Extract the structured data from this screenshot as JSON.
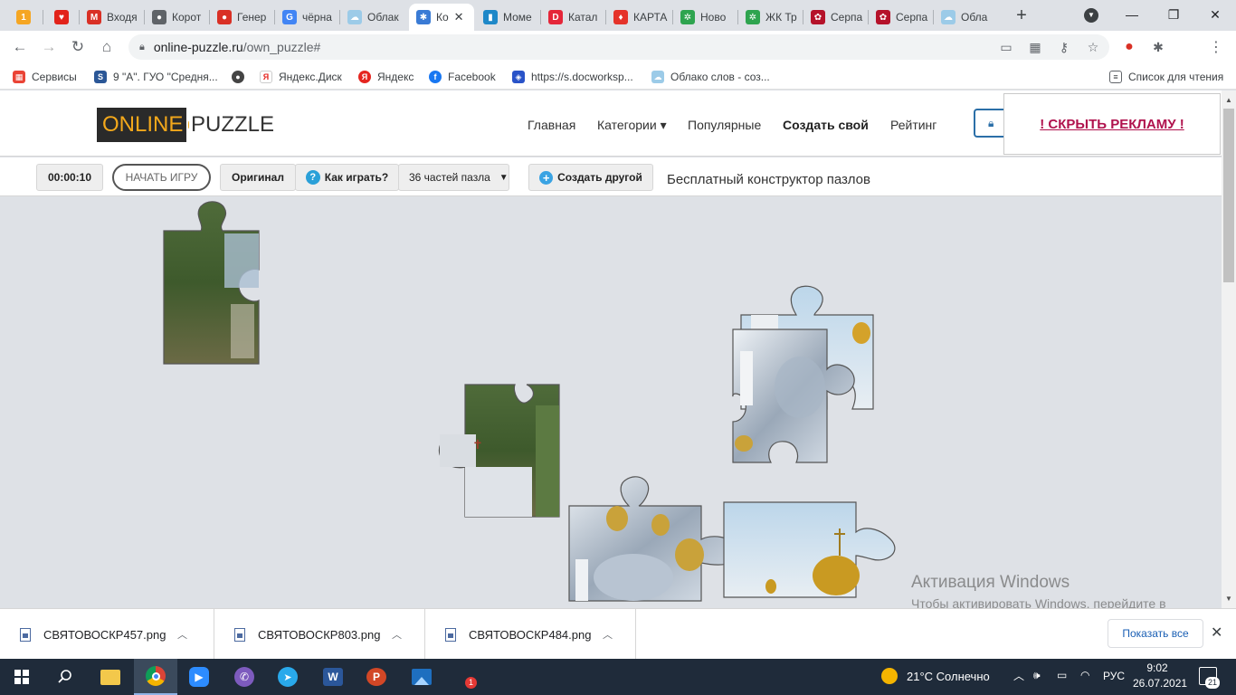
{
  "browser": {
    "tabs": [
      {
        "label": "",
        "color": "#f5a623",
        "glyph": "1"
      },
      {
        "label": "",
        "color": "#e2231a",
        "glyph": "♥"
      },
      {
        "label": "Входя",
        "color": "#d93025",
        "glyph": "M"
      },
      {
        "label": "Корот",
        "color": "#5f6368",
        "glyph": "●"
      },
      {
        "label": "Генер",
        "color": "#d93025",
        "glyph": "●"
      },
      {
        "label": "чёрна",
        "color": "#4285f4",
        "glyph": "G"
      },
      {
        "label": "Облак",
        "color": "#9ccbe8",
        "glyph": "☁"
      },
      {
        "label": "Ко",
        "color": "#3a7bd5",
        "glyph": "✱"
      },
      {
        "label": "Моме",
        "color": "#1e88c8",
        "glyph": "▮"
      },
      {
        "label": "Катал",
        "color": "#e52639",
        "glyph": "D"
      },
      {
        "label": "КАРТА",
        "color": "#e5332a",
        "glyph": "♦"
      },
      {
        "label": "Ново",
        "color": "#2ea44f",
        "glyph": "✲"
      },
      {
        "label": "ЖК Тр",
        "color": "#2ea44f",
        "glyph": "✲"
      },
      {
        "label": "Серпа",
        "color": "#b5122a",
        "glyph": "✿"
      },
      {
        "label": "Серпа",
        "color": "#b5122a",
        "glyph": "✿"
      },
      {
        "label": "Обла",
        "color": "#9ccbe8",
        "glyph": "☁"
      }
    ],
    "new_tab": "+",
    "url_main": "online-puzzle.ru",
    "url_rest": "/own_puzzle#",
    "profile_initial": "O",
    "ext_badge": "4",
    "bookmarks": [
      {
        "label": "Сервисы",
        "color": "#ea4335",
        "glyph": "▦"
      },
      {
        "label": "9 \"А\". ГУО \"Средня...",
        "color": "#2b5797",
        "glyph": "S"
      },
      {
        "label": "",
        "color": "#444",
        "glyph": "●"
      },
      {
        "label": "Яндекс.Диск",
        "color": "#e52620",
        "glyph": "Я"
      },
      {
        "label": "Яндекс",
        "color": "#e52620",
        "glyph": "Я"
      },
      {
        "label": "Facebook",
        "color": "#1877f2",
        "glyph": "f"
      },
      {
        "label": "https://s.docworksp...",
        "color": "#2953c8",
        "glyph": "◈"
      },
      {
        "label": "Облако слов - соз...",
        "color": "#9ccbe8",
        "glyph": "☁"
      }
    ],
    "reading_list": "Список для чтения"
  },
  "site": {
    "logo_left": "ONLINE",
    "logo_right": "PUZZLE",
    "nav": {
      "home": "Главная",
      "categories": "Категории ▾",
      "popular": "Популярные",
      "create": "Создать свой",
      "rating": "Рейтинг"
    },
    "ad_hide": "! СКРЫТЬ РЕКЛАМУ !"
  },
  "puzzle_toolbar": {
    "timer": "00:00:10",
    "start": "НАЧАТЬ ИГРУ",
    "original": "Оригинал",
    "how_to_play": "Как играть?",
    "pieces_select": "36 частей пазла",
    "create_other": "Создать другой",
    "tagline": "Бесплатный конструктор пазлов"
  },
  "watermark": {
    "title": "Активация Windows",
    "text": "Чтобы активировать Windows, перейдите в раздел \"Параметры\"."
  },
  "downloads": {
    "files": [
      "СВЯТОВОСКР457.png",
      "СВЯТОВОСКР803.png",
      "СВЯТОВОСКР484.png"
    ],
    "show_all": "Показать все"
  },
  "taskbar": {
    "weather": "21°C  Солнечно",
    "lang": "РУС",
    "time": "9:02",
    "date": "26.07.2021",
    "notifications": "21",
    "viber_badge": "1"
  }
}
